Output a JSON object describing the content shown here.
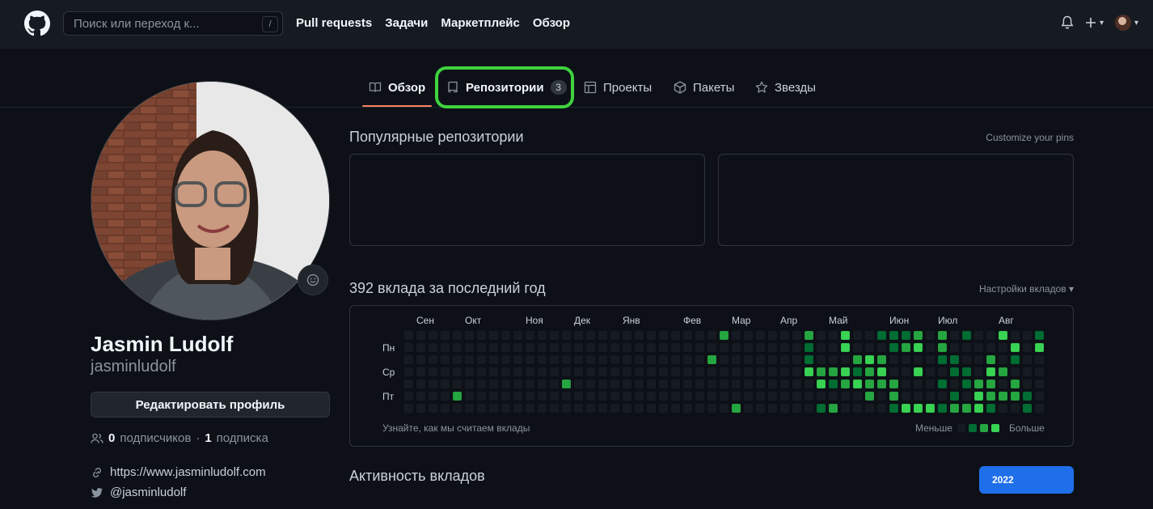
{
  "header": {
    "search_placeholder": "Поиск или переход к...",
    "search_shortcut": "/",
    "nav": [
      "Pull requests",
      "Задачи",
      "Маркетплейс",
      "Обзор"
    ]
  },
  "tabs": [
    {
      "label": "Обзор",
      "icon": "book-icon",
      "active": true
    },
    {
      "label": "Репозитории",
      "icon": "repo-icon",
      "count": "3",
      "highlighted": true
    },
    {
      "label": "Проекты",
      "icon": "table-icon"
    },
    {
      "label": "Пакеты",
      "icon": "package-icon"
    },
    {
      "label": "Звезды",
      "icon": "star-icon"
    }
  ],
  "profile": {
    "name": "Jasmin Ludolf",
    "login": "jasminludolf",
    "edit_label": "Редактировать профиль",
    "followers_count": "0",
    "followers_label": "подписчиков",
    "separator": "·",
    "following_count": "1",
    "following_label": "подписка",
    "website": "https://www.jasminludolf.com",
    "twitter": "@jasminludolf"
  },
  "popular": {
    "title": "Популярные репозитории",
    "customize_label": "Customize your pins"
  },
  "contributions": {
    "title": "392 вклада за последний год",
    "settings_label": "Настройки вкладов ▾",
    "months": [
      "Сен",
      "Окт",
      "Ноя",
      "Дек",
      "Янв",
      "Фев",
      "Мар",
      "Апр",
      "Май",
      "Июн",
      "Июл",
      "Авг"
    ],
    "days": [
      "Пн",
      "Ср",
      "Пт"
    ],
    "learn_label": "Узнайте, как мы считаем вклады",
    "less_label": "Меньше",
    "more_label": "Больше",
    "activity_title": "Активность вкладов",
    "year": "2022"
  },
  "colors": {
    "accent": "#1f6feb",
    "highlight": "#3fd23f",
    "level0": "#161b22",
    "level1": "#0e4429",
    "level2": "#006d32",
    "level3": "#26a641",
    "level4": "#39d353"
  }
}
